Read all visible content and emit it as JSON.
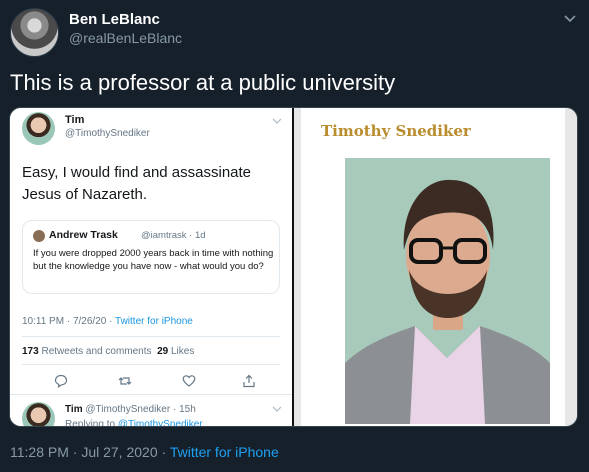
{
  "author": {
    "name": "Ben LeBlanc",
    "handle": "@realBenLeBlanc"
  },
  "tweet": {
    "text": "This is a professor at a public university"
  },
  "embedded_tweet": {
    "name": "Tim",
    "handle": "@TimothySnediker",
    "text": "Easy, I would find and assassinate Jesus of Nazareth.",
    "quoted": {
      "name": "Andrew Trask",
      "meta": "@iamtrask · 1d",
      "text": "If you were dropped 2000 years back in time with nothing but the knowledge you have now - what would you do?"
    },
    "timestamp": "10:11 PM · 7/26/20 ·",
    "source": "Twitter for iPhone",
    "retweets_count": "173",
    "retweets_label": "Retweets and comments",
    "likes_count": "29",
    "likes_label": "Likes",
    "reply": {
      "name": "Tim",
      "meta": "@TimothySnediker · 15h",
      "replying_prefix": "Replying to",
      "replying_to": "@TimothySnediker"
    }
  },
  "profile_panel": {
    "title": "Timothy Snediker"
  },
  "footer": {
    "time": "11:28 PM · Jul 27, 2020 ·",
    "source": "Twitter for iPhone"
  },
  "colors": {
    "background": "#15202b",
    "link": "#1da1f2",
    "muted": "#8899a6",
    "profile_title": "#b98c2e"
  }
}
